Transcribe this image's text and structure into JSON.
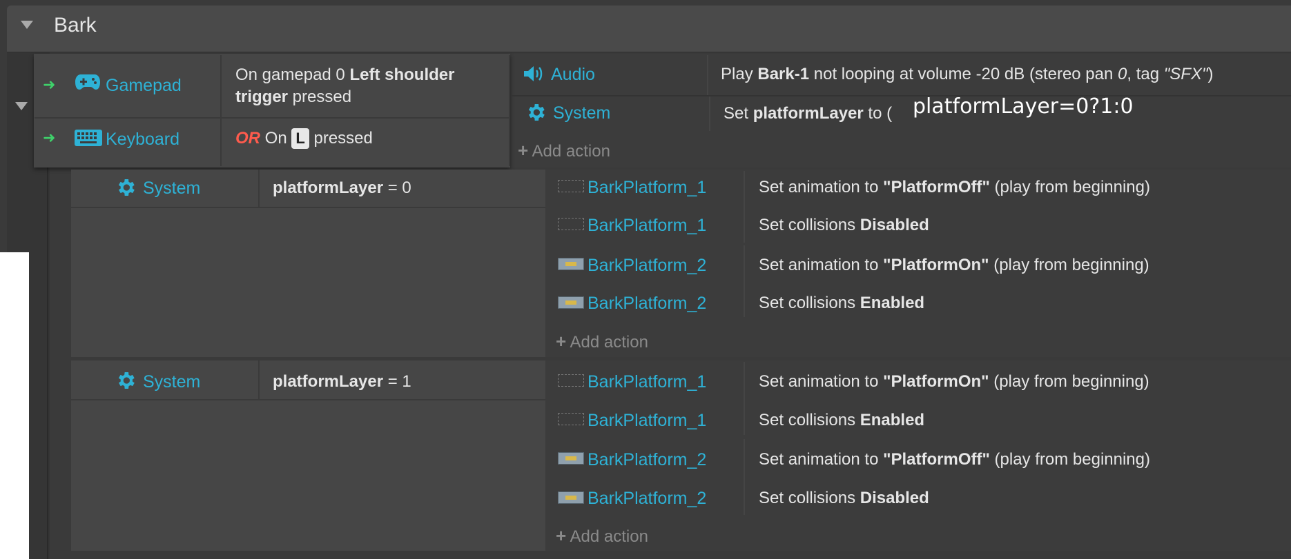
{
  "group": {
    "title": "Bark"
  },
  "top_event": {
    "conditions": [
      {
        "object": "Gamepad",
        "icon": "gamepad-icon",
        "parts": {
          "pre": "On gamepad 0 ",
          "b1": "Left shoulder",
          "line2_b": "trigger",
          "line2_post": " pressed"
        }
      },
      {
        "object": "Keyboard",
        "icon": "keyboard-icon",
        "or_label": "OR",
        "on": " On ",
        "key": "L",
        "post": " pressed"
      }
    ],
    "actions": [
      {
        "object": "Audio",
        "icon": "speaker-icon",
        "parts": {
          "t1": "Play ",
          "b1": "Bark-1",
          "t2": " not looping at volume -20 dB (stereo pan ",
          "i1": "0",
          "t3": ", tag ",
          "i2": "\"SFX\"",
          "t4": ")"
        }
      },
      {
        "object": "System",
        "icon": "gear-icon",
        "parts": {
          "t1": "Set ",
          "b1": "platformLayer",
          "t2": " to ("
        }
      }
    ],
    "add_action": "Add action",
    "overlay_expression": "platformLayer=0?1:0"
  },
  "sub_events": [
    {
      "condition": {
        "object": "System",
        "icon": "gear-icon",
        "var": "platformLayer",
        "rest": " = 0"
      },
      "actions": [
        {
          "object": "BarkPlatform_1",
          "icon": "platform-empty-icon",
          "t1": "Set animation to ",
          "b1": "\"PlatformOff\"",
          "t2": " (play from beginning)"
        },
        {
          "object": "BarkPlatform_1",
          "icon": "platform-empty-icon",
          "t1": "Set collisions ",
          "b1": "Disabled",
          "t2": ""
        },
        {
          "object": "BarkPlatform_2",
          "icon": "platform-image-icon",
          "t1": "Set animation to ",
          "b1": "\"PlatformOn\"",
          "t2": " (play from beginning)"
        },
        {
          "object": "BarkPlatform_2",
          "icon": "platform-image-icon",
          "t1": "Set collisions ",
          "b1": "Enabled",
          "t2": ""
        }
      ],
      "add_action": "Add action"
    },
    {
      "condition": {
        "object": "System",
        "icon": "gear-icon",
        "var": "platformLayer",
        "rest": " = 1"
      },
      "actions": [
        {
          "object": "BarkPlatform_1",
          "icon": "platform-empty-icon",
          "t1": "Set animation to ",
          "b1": "\"PlatformOn\"",
          "t2": " (play from beginning)"
        },
        {
          "object": "BarkPlatform_1",
          "icon": "platform-empty-icon",
          "t1": "Set collisions ",
          "b1": "Enabled",
          "t2": ""
        },
        {
          "object": "BarkPlatform_2",
          "icon": "platform-image-icon",
          "t1": "Set animation to ",
          "b1": "\"PlatformOff\"",
          "t2": " (play from beginning)"
        },
        {
          "object": "BarkPlatform_2",
          "icon": "platform-image-icon",
          "t1": "Set collisions ",
          "b1": "Disabled",
          "t2": ""
        }
      ],
      "add_action": "Add action"
    }
  ],
  "colors": {
    "link": "#2eb2d6",
    "or": "#ff5b4d",
    "arrow": "#3fd06a",
    "panel": "#3c3c3c",
    "condition": "#464646"
  }
}
